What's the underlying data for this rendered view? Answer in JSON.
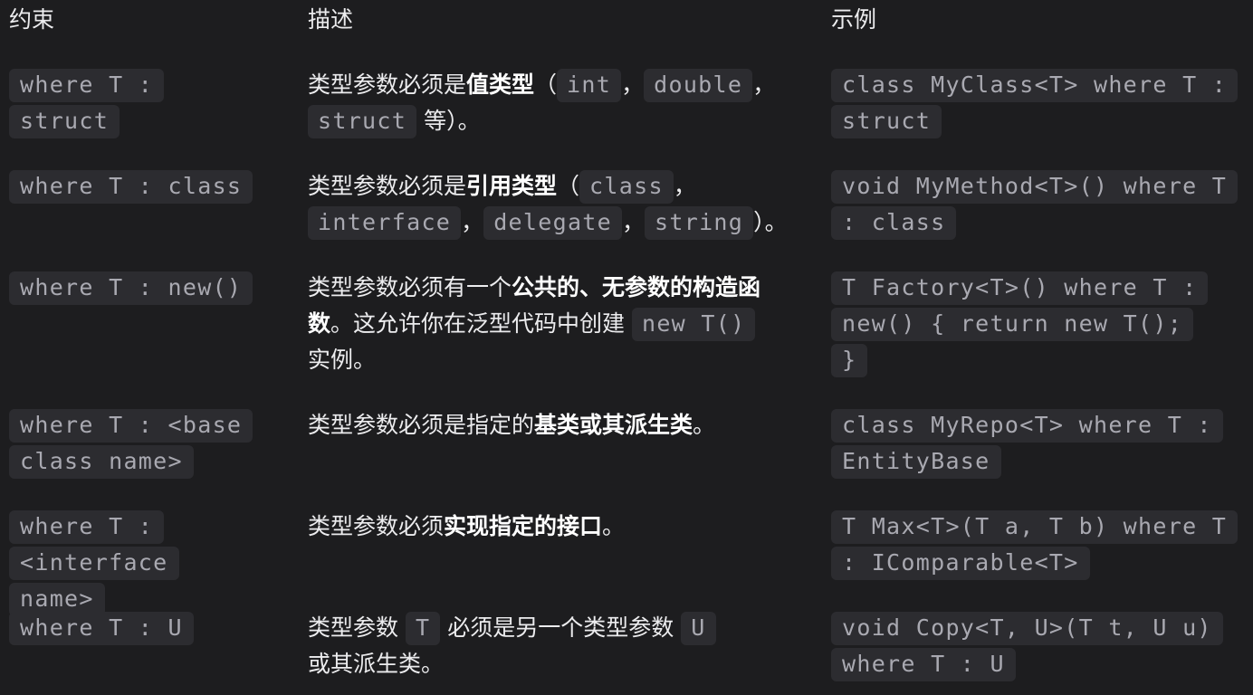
{
  "headers": {
    "constraint": "约束",
    "description": "描述",
    "example": "示例"
  },
  "rows": [
    {
      "constraint": "where T : struct",
      "desc": {
        "t1": "类型参数必须是",
        "b1": "值类型",
        "t2": "（",
        "c1": "int",
        "t3": "，",
        "c2": "double",
        "t4": "，",
        "c3": "struct",
        "t5": "等）。"
      },
      "example": "class MyClass<T> where T : struct"
    },
    {
      "constraint": "where T : class",
      "desc": {
        "t1": "类型参数必须是",
        "b1": "引用类型",
        "t2": "（",
        "c1": "class",
        "t3": "，",
        "c2": "interface",
        "t4": "，",
        "c3": "delegate",
        "t5": "，",
        "c4": "string",
        "t6": "）。"
      },
      "example": "void MyMethod<T>() where T : class"
    },
    {
      "constraint": "where T : new()",
      "desc": {
        "t1": "类型参数必须有一个",
        "b1": "公共的、无参数的构造函数",
        "t2": "。这允许你在泛型代码中创建",
        "c1": "new T()",
        "t3": "实例。"
      },
      "example": "T Factory<T>() where T : new() { return new T(); }"
    },
    {
      "constraint": "where T : <base class name>",
      "desc": {
        "t1": "类型参数必须是指定的",
        "b1": "基类或其派生类",
        "t2": "。"
      },
      "example": "class MyRepo<T> where T : EntityBase"
    },
    {
      "constraint": "where T : <interface name>",
      "desc": {
        "t1": "类型参数必须",
        "b1": "实现指定的接口",
        "t2": "。"
      },
      "example": "T Max<T>(T a, T b) where T : IComparable<T>"
    },
    {
      "constraint": "where T : U",
      "desc": {
        "t1": "类型参数",
        "c1": "T",
        "t2": "必须是另一个类型参数",
        "c2": "U",
        "t3": "或其派生类。"
      },
      "example": "void Copy<T, U>(T t, U u) where T : U"
    }
  ]
}
